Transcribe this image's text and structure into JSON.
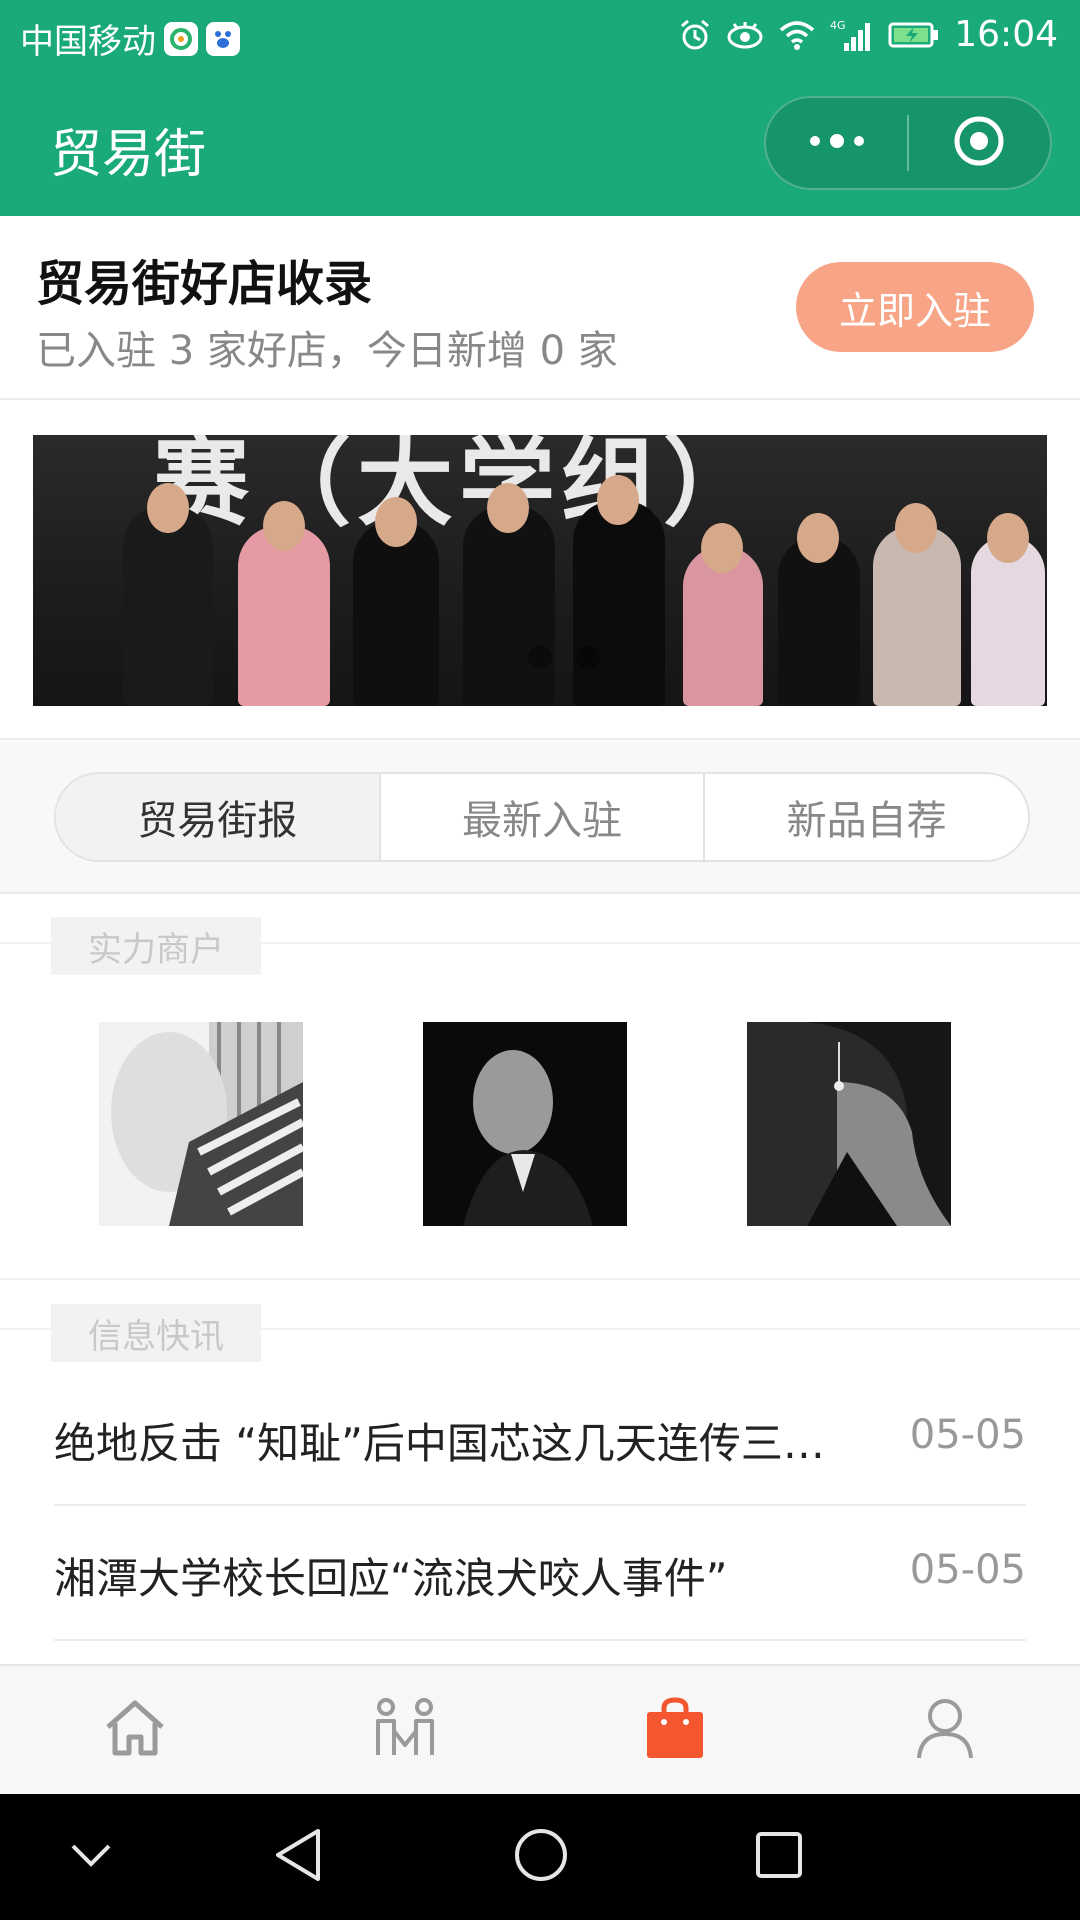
{
  "status_bar": {
    "carrier": "中国移动",
    "time": "16:04",
    "network": "4G",
    "icons": [
      "app-icon-1",
      "baidu-icon",
      "alarm-icon",
      "eye-icon",
      "wifi-icon",
      "signal-icon",
      "battery-icon"
    ]
  },
  "nav": {
    "title": "贸易街",
    "more_icon": "more-dots-icon",
    "close_icon": "target-icon"
  },
  "intro": {
    "title": "贸易街好店收录",
    "subtitle": "已入驻 3 家好店，今日新增 0 家",
    "join_button": "立即入驻"
  },
  "banner": {
    "text": "赛（大学组）",
    "dot_count": 3,
    "active_index": 0
  },
  "tabs": [
    {
      "label": "贸易街报",
      "active": true
    },
    {
      "label": "最新入驻",
      "active": false
    },
    {
      "label": "新品自荐",
      "active": false
    }
  ],
  "merchants_section": {
    "label": "实力商户",
    "merchants": [
      {
        "name": "merchant-1"
      },
      {
        "name": "merchant-2"
      },
      {
        "name": "merchant-3"
      }
    ]
  },
  "news_section": {
    "label": "信息快讯",
    "items": [
      {
        "title": "绝地反击 “知耻”后中国芯这几天连传三…",
        "date": "05-05"
      },
      {
        "title": "湘潭大学校长回应“流浪犬咬人事件”",
        "date": "05-05"
      }
    ]
  },
  "tabbar": {
    "items": [
      {
        "icon": "home-icon",
        "active": false
      },
      {
        "icon": "people-icon",
        "active": false
      },
      {
        "icon": "shopping-bag-icon",
        "active": true
      },
      {
        "icon": "user-icon",
        "active": false
      }
    ],
    "active_color": "#f4572f",
    "inactive_color": "#9a9a9a"
  },
  "colors": {
    "brand_green": "#1aaa7a",
    "join_button": "#f7a487"
  }
}
